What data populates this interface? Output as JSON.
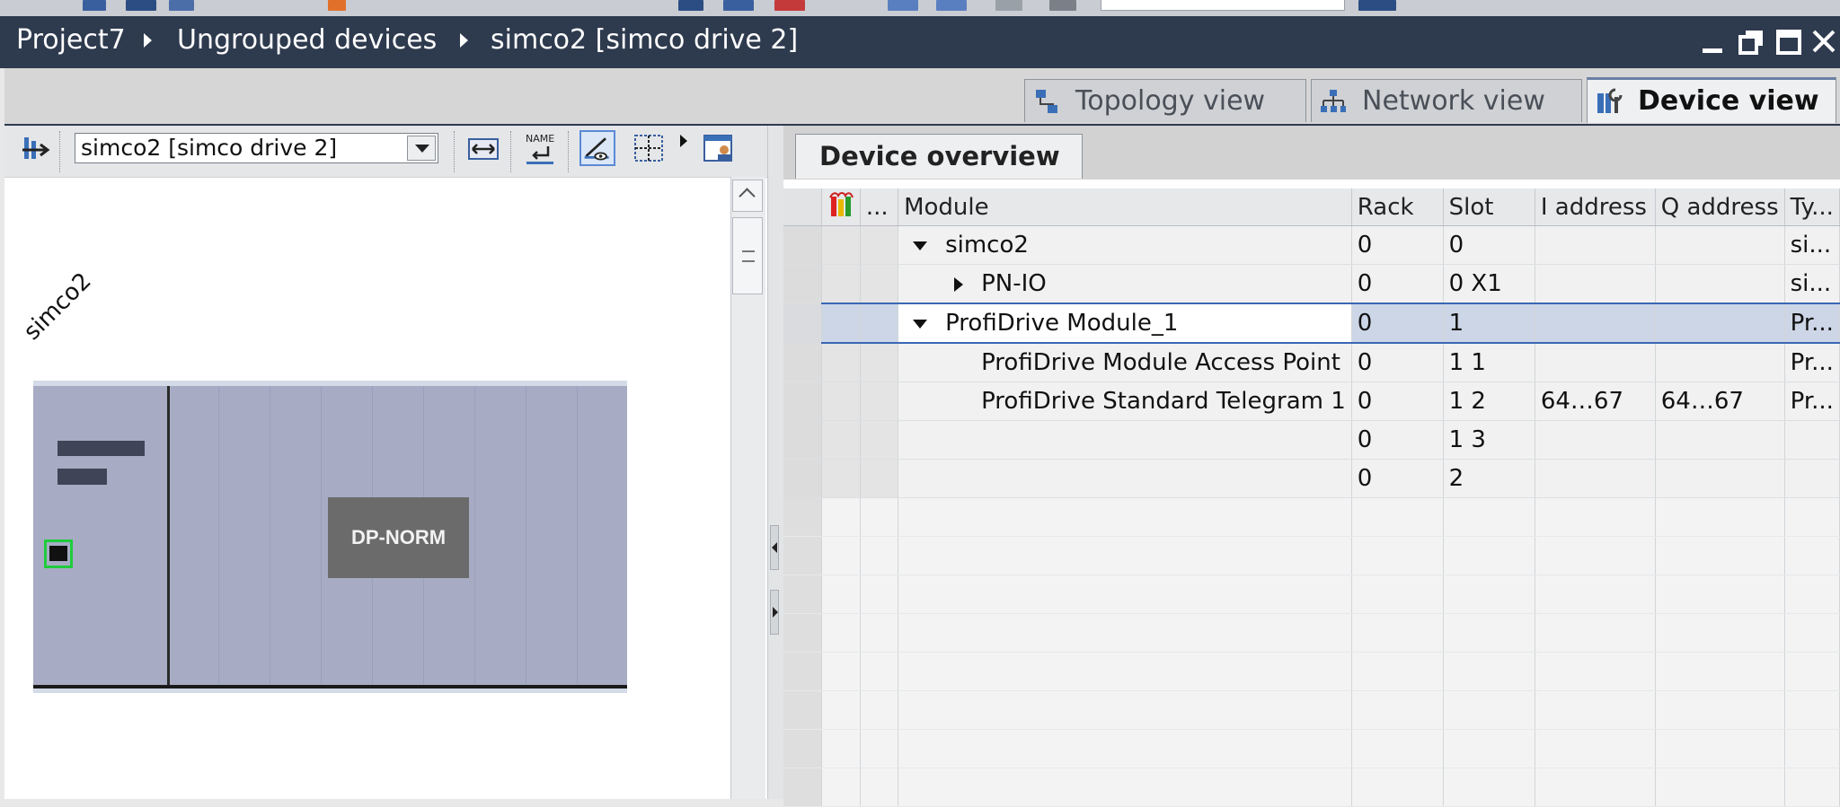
{
  "breadcrumb": {
    "project": "Project7",
    "group": "Ungrouped devices",
    "device": "simco2 [simco drive 2]"
  },
  "window_controls": [
    "minimize-icon",
    "restore-icon",
    "maximize-icon",
    "close-icon"
  ],
  "view_tabs": [
    {
      "label": "Topology view",
      "icon": "topology-icon",
      "active": false
    },
    {
      "label": "Network view",
      "icon": "network-icon",
      "active": false
    },
    {
      "label": "Device view",
      "icon": "device-icon",
      "active": true
    }
  ],
  "left_toolbar": {
    "device_select_value": "simco2 [simco drive 2]",
    "name_icon_text": "NAME"
  },
  "device_canvas": {
    "device_label": "simco2",
    "module_label": "DP-NORM"
  },
  "overview": {
    "tab_label": "Device overview",
    "columns": [
      "",
      "...",
      "Module",
      "Rack",
      "Slot",
      "I address",
      "Q address",
      "Ty..."
    ],
    "rows": [
      {
        "module": "simco2",
        "rack": "0",
        "slot": "0",
        "i_address": "",
        "q_address": "",
        "type": "si...",
        "expand": "down",
        "indent": 0
      },
      {
        "module": "PN-IO",
        "rack": "0",
        "slot": "0 X1",
        "i_address": "",
        "q_address": "",
        "type": "si...",
        "expand": "right",
        "indent": 1
      },
      {
        "module": "ProfiDrive Module_1",
        "rack": "0",
        "slot": "1",
        "i_address": "",
        "q_address": "",
        "type": "Pr...",
        "expand": "down",
        "indent": 0,
        "selected": true
      },
      {
        "module": "ProfiDrive Module Access Point",
        "rack": "0",
        "slot": "1 1",
        "i_address": "",
        "q_address": "",
        "type": "Pr...",
        "expand": "none",
        "indent": 2
      },
      {
        "module": "ProfiDrive Standard Telegram 1",
        "rack": "0",
        "slot": "1 2",
        "i_address": "64…67",
        "q_address": "64…67",
        "type": "Pr...",
        "expand": "none",
        "indent": 2
      },
      {
        "module": "",
        "rack": "0",
        "slot": "1 3",
        "i_address": "",
        "q_address": "",
        "type": "",
        "expand": "none",
        "indent": 0
      },
      {
        "module": "",
        "rack": "0",
        "slot": "2",
        "i_address": "",
        "q_address": "",
        "type": "",
        "expand": "none",
        "indent": 0
      }
    ]
  },
  "colors": {
    "titlebar": "#2e3a4e",
    "selection_border": "#3a67b4",
    "rack": "#a7acc4",
    "port_highlight": "#1fcc3d"
  }
}
